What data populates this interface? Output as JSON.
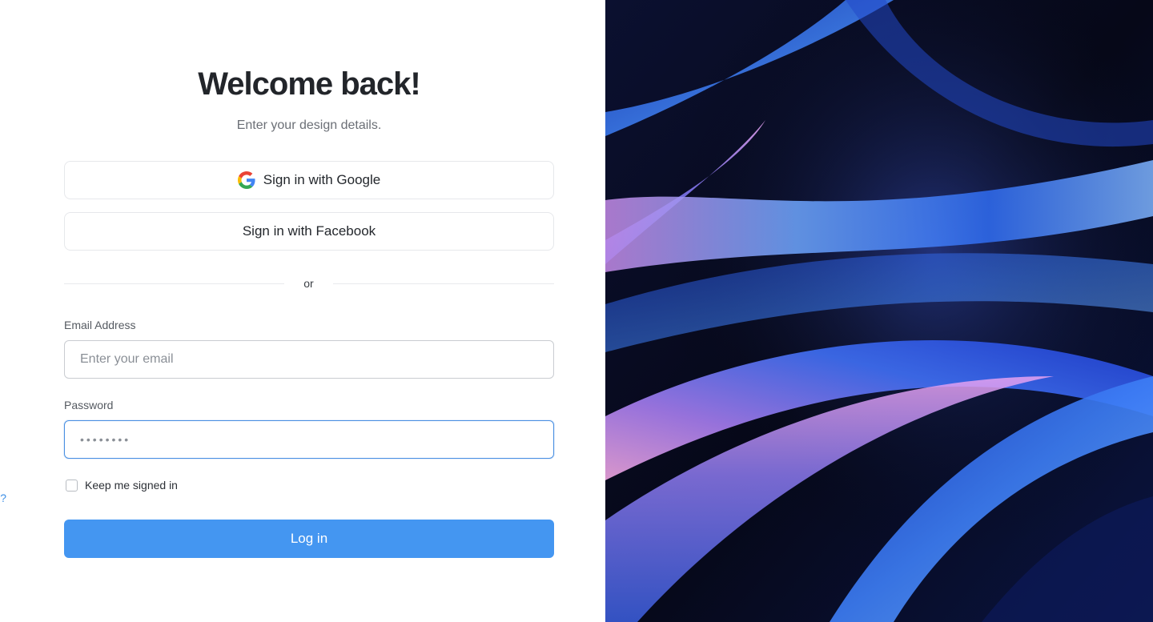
{
  "header": {
    "title": "Welcome back!",
    "subtitle": "Enter your design details."
  },
  "social": {
    "google_label": "Sign in with Google",
    "facebook_label": "Sign in with Facebook",
    "google_icon": "google-icon"
  },
  "divider": {
    "text": "or"
  },
  "form": {
    "email_label": "Email Address",
    "email_placeholder": "Enter your email",
    "email_value": "",
    "password_label": "Password",
    "password_value": "••••••••",
    "remember_label": "Keep me signed in",
    "remember_checked": false,
    "forgot_label": "Forget password?",
    "login_label": "Log in"
  },
  "colors": {
    "accent": "#4496f1",
    "link": "#3d8fe6",
    "focus_border": "#4a90e2"
  },
  "hero": {
    "image": "abstract-ribbon-artwork"
  }
}
